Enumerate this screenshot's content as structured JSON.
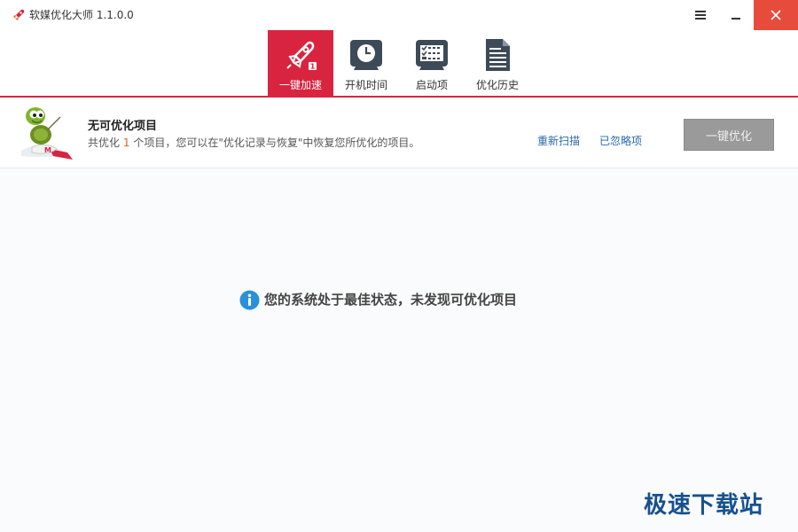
{
  "window": {
    "title": "软媒优化大师 1.1.0.0"
  },
  "toolbar": {
    "items": [
      {
        "label": "一键加速",
        "icon": "rocket-icon",
        "active": true
      },
      {
        "label": "开机时间",
        "icon": "clock-icon",
        "active": false
      },
      {
        "label": "启动项",
        "icon": "checklist-icon",
        "active": false
      },
      {
        "label": "优化历史",
        "icon": "document-icon",
        "active": false
      }
    ],
    "rocket_badge": "1"
  },
  "status": {
    "title": "无可优化项目",
    "desc_prefix": "共优化",
    "desc_count": "1",
    "desc_suffix": "个项目，您可以在\"优化记录与恢复\"中恢复您所优化的项目。",
    "rescan_label": "重新扫描",
    "ignored_label": "已忽略项",
    "optimize_label": "一键优化",
    "mascot_badge": "M"
  },
  "main": {
    "empty_message": "您的系统处于最佳状态，未发现可优化项目"
  },
  "watermark": "极速下载站",
  "colors": {
    "accent": "#d9243f",
    "close": "#e74b3c",
    "link": "#2a68b0",
    "count": "#e8601c",
    "info": "#2b8fd9"
  }
}
